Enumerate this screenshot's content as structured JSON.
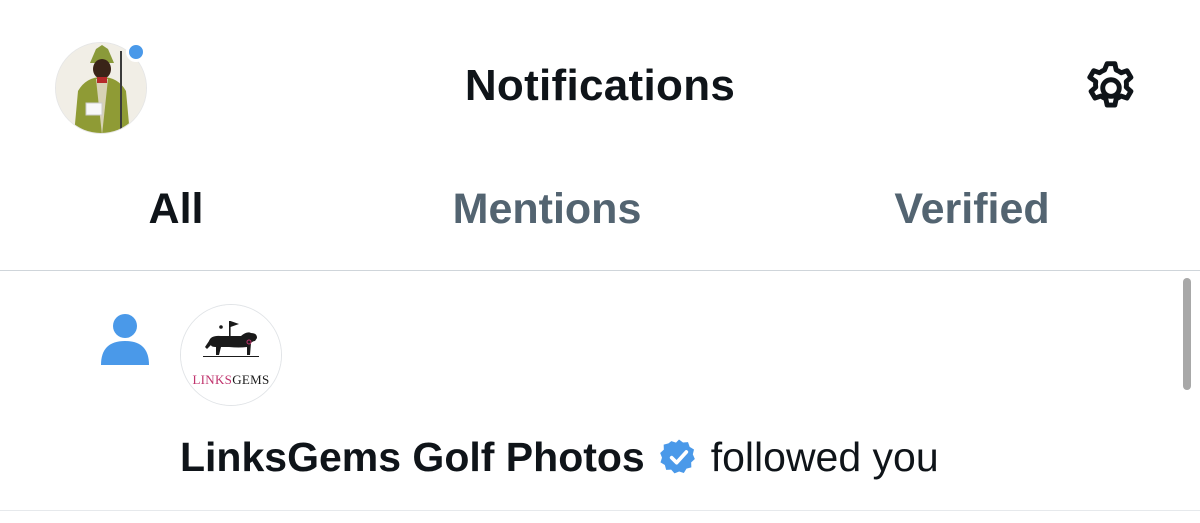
{
  "header": {
    "title": "Notifications",
    "profile_avatar_icon": "user-avatar",
    "has_unread_dot": true,
    "settings_icon": "gear-icon"
  },
  "tabs": [
    {
      "label": "All",
      "active": true
    },
    {
      "label": "Mentions",
      "active": false
    },
    {
      "label": "Verified",
      "active": false
    }
  ],
  "notifications": [
    {
      "type": "follow",
      "type_icon": "person-icon",
      "account_name": "LinksGems Golf Photos",
      "verified": true,
      "action": "followed you",
      "avatar_logo_text": "LINKSGEMS"
    }
  ],
  "colors": {
    "accent": "#4a99e9",
    "text_primary": "#0f1419",
    "text_secondary": "#536471",
    "logo_pink": "#c0336d"
  }
}
